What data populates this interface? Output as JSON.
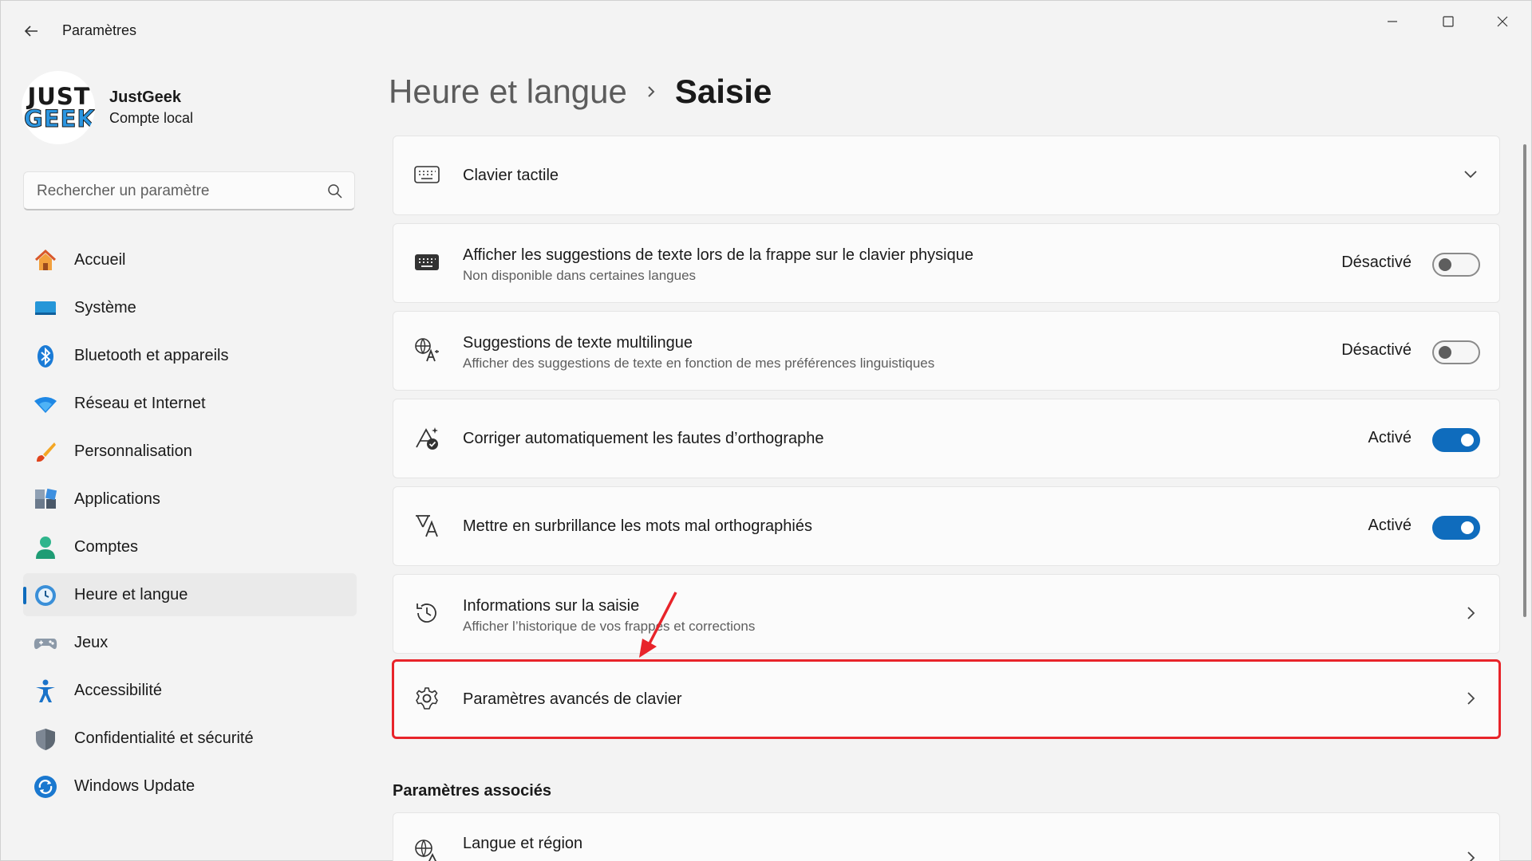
{
  "window": {
    "title": "Paramètres",
    "minimize_label": "",
    "maximize_label": "",
    "close_label": ""
  },
  "profile": {
    "logo_line1": "JUST",
    "logo_line2": "GEEK",
    "name": "JustGeek",
    "account_type": "Compte local"
  },
  "search": {
    "placeholder": "Rechercher un paramètre"
  },
  "nav": {
    "items": [
      {
        "label": "Accueil",
        "icon": "home-icon"
      },
      {
        "label": "Système",
        "icon": "display-icon"
      },
      {
        "label": "Bluetooth et appareils",
        "icon": "bluetooth-icon"
      },
      {
        "label": "Réseau et Internet",
        "icon": "wifi-icon"
      },
      {
        "label": "Personnalisation",
        "icon": "brush-icon"
      },
      {
        "label": "Applications",
        "icon": "apps-icon"
      },
      {
        "label": "Comptes",
        "icon": "person-icon"
      },
      {
        "label": "Heure et langue",
        "icon": "globe-clock-icon",
        "active": true
      },
      {
        "label": "Jeux",
        "icon": "gamepad-icon"
      },
      {
        "label": "Accessibilité",
        "icon": "accessibility-icon"
      },
      {
        "label": "Confidentialité et sécurité",
        "icon": "shield-icon"
      },
      {
        "label": "Windows Update",
        "icon": "update-icon"
      }
    ]
  },
  "breadcrumb": {
    "parent": "Heure et langue",
    "current": "Saisie"
  },
  "settings": [
    {
      "title": "Clavier tactile",
      "subtitle": "",
      "control": "expand",
      "icon": "touch-keyboard-icon"
    },
    {
      "title": "Afficher les suggestions de texte lors de la frappe sur le clavier physique",
      "subtitle": "Non disponible dans certaines langues",
      "control": "toggle",
      "state": "Désactivé",
      "on": false,
      "icon": "keyboard-icon"
    },
    {
      "title": "Suggestions de texte multilingue",
      "subtitle": "Afficher des suggestions de texte en fonction de mes préférences linguistiques",
      "control": "toggle",
      "state": "Désactivé",
      "on": false,
      "icon": "translate-icon"
    },
    {
      "title": "Corriger automatiquement les fautes d’orthographe",
      "subtitle": "",
      "control": "toggle",
      "state": "Activé",
      "on": true,
      "icon": "autocorrect-icon"
    },
    {
      "title": "Mettre en surbrillance les mots mal orthographiés",
      "subtitle": "",
      "control": "toggle",
      "state": "Activé",
      "on": true,
      "icon": "spellcheck-icon"
    },
    {
      "title": "Informations sur la saisie",
      "subtitle": "Afficher l’historique de vos frappes et corrections",
      "control": "navigate",
      "icon": "history-icon"
    },
    {
      "title": "Paramètres avancés de clavier",
      "subtitle": "",
      "control": "navigate",
      "icon": "gear-icon",
      "highlighted": true
    }
  ],
  "related": {
    "section_title": "Paramètres associés",
    "items": [
      {
        "title": "Langue et région",
        "icon": "language-region-icon"
      }
    ]
  },
  "colors": {
    "accent": "#0f6cbd",
    "highlight": "#e8242a",
    "background": "#f3f3f3",
    "card": "#fbfbfb"
  }
}
